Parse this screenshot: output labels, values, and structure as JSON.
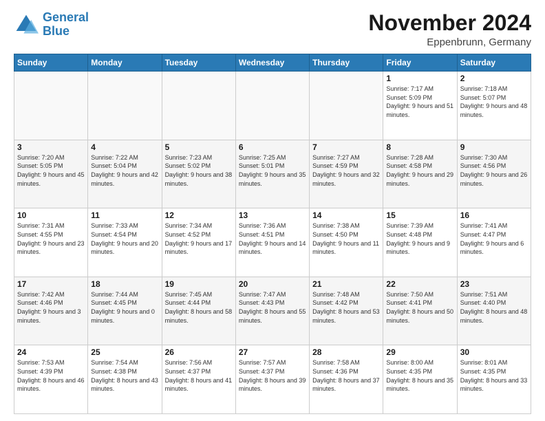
{
  "header": {
    "logo_line1": "General",
    "logo_line2": "Blue",
    "title": "November 2024",
    "subtitle": "Eppenbrunn, Germany"
  },
  "weekdays": [
    "Sunday",
    "Monday",
    "Tuesday",
    "Wednesday",
    "Thursday",
    "Friday",
    "Saturday"
  ],
  "weeks": [
    [
      {
        "day": "",
        "info": ""
      },
      {
        "day": "",
        "info": ""
      },
      {
        "day": "",
        "info": ""
      },
      {
        "day": "",
        "info": ""
      },
      {
        "day": "",
        "info": ""
      },
      {
        "day": "1",
        "info": "Sunrise: 7:17 AM\nSunset: 5:09 PM\nDaylight: 9 hours and 51 minutes."
      },
      {
        "day": "2",
        "info": "Sunrise: 7:18 AM\nSunset: 5:07 PM\nDaylight: 9 hours and 48 minutes."
      }
    ],
    [
      {
        "day": "3",
        "info": "Sunrise: 7:20 AM\nSunset: 5:05 PM\nDaylight: 9 hours and 45 minutes."
      },
      {
        "day": "4",
        "info": "Sunrise: 7:22 AM\nSunset: 5:04 PM\nDaylight: 9 hours and 42 minutes."
      },
      {
        "day": "5",
        "info": "Sunrise: 7:23 AM\nSunset: 5:02 PM\nDaylight: 9 hours and 38 minutes."
      },
      {
        "day": "6",
        "info": "Sunrise: 7:25 AM\nSunset: 5:01 PM\nDaylight: 9 hours and 35 minutes."
      },
      {
        "day": "7",
        "info": "Sunrise: 7:27 AM\nSunset: 4:59 PM\nDaylight: 9 hours and 32 minutes."
      },
      {
        "day": "8",
        "info": "Sunrise: 7:28 AM\nSunset: 4:58 PM\nDaylight: 9 hours and 29 minutes."
      },
      {
        "day": "9",
        "info": "Sunrise: 7:30 AM\nSunset: 4:56 PM\nDaylight: 9 hours and 26 minutes."
      }
    ],
    [
      {
        "day": "10",
        "info": "Sunrise: 7:31 AM\nSunset: 4:55 PM\nDaylight: 9 hours and 23 minutes."
      },
      {
        "day": "11",
        "info": "Sunrise: 7:33 AM\nSunset: 4:54 PM\nDaylight: 9 hours and 20 minutes."
      },
      {
        "day": "12",
        "info": "Sunrise: 7:34 AM\nSunset: 4:52 PM\nDaylight: 9 hours and 17 minutes."
      },
      {
        "day": "13",
        "info": "Sunrise: 7:36 AM\nSunset: 4:51 PM\nDaylight: 9 hours and 14 minutes."
      },
      {
        "day": "14",
        "info": "Sunrise: 7:38 AM\nSunset: 4:50 PM\nDaylight: 9 hours and 11 minutes."
      },
      {
        "day": "15",
        "info": "Sunrise: 7:39 AM\nSunset: 4:48 PM\nDaylight: 9 hours and 9 minutes."
      },
      {
        "day": "16",
        "info": "Sunrise: 7:41 AM\nSunset: 4:47 PM\nDaylight: 9 hours and 6 minutes."
      }
    ],
    [
      {
        "day": "17",
        "info": "Sunrise: 7:42 AM\nSunset: 4:46 PM\nDaylight: 9 hours and 3 minutes."
      },
      {
        "day": "18",
        "info": "Sunrise: 7:44 AM\nSunset: 4:45 PM\nDaylight: 9 hours and 0 minutes."
      },
      {
        "day": "19",
        "info": "Sunrise: 7:45 AM\nSunset: 4:44 PM\nDaylight: 8 hours and 58 minutes."
      },
      {
        "day": "20",
        "info": "Sunrise: 7:47 AM\nSunset: 4:43 PM\nDaylight: 8 hours and 55 minutes."
      },
      {
        "day": "21",
        "info": "Sunrise: 7:48 AM\nSunset: 4:42 PM\nDaylight: 8 hours and 53 minutes."
      },
      {
        "day": "22",
        "info": "Sunrise: 7:50 AM\nSunset: 4:41 PM\nDaylight: 8 hours and 50 minutes."
      },
      {
        "day": "23",
        "info": "Sunrise: 7:51 AM\nSunset: 4:40 PM\nDaylight: 8 hours and 48 minutes."
      }
    ],
    [
      {
        "day": "24",
        "info": "Sunrise: 7:53 AM\nSunset: 4:39 PM\nDaylight: 8 hours and 46 minutes."
      },
      {
        "day": "25",
        "info": "Sunrise: 7:54 AM\nSunset: 4:38 PM\nDaylight: 8 hours and 43 minutes."
      },
      {
        "day": "26",
        "info": "Sunrise: 7:56 AM\nSunset: 4:37 PM\nDaylight: 8 hours and 41 minutes."
      },
      {
        "day": "27",
        "info": "Sunrise: 7:57 AM\nSunset: 4:37 PM\nDaylight: 8 hours and 39 minutes."
      },
      {
        "day": "28",
        "info": "Sunrise: 7:58 AM\nSunset: 4:36 PM\nDaylight: 8 hours and 37 minutes."
      },
      {
        "day": "29",
        "info": "Sunrise: 8:00 AM\nSunset: 4:35 PM\nDaylight: 8 hours and 35 minutes."
      },
      {
        "day": "30",
        "info": "Sunrise: 8:01 AM\nSunset: 4:35 PM\nDaylight: 8 hours and 33 minutes."
      }
    ]
  ]
}
